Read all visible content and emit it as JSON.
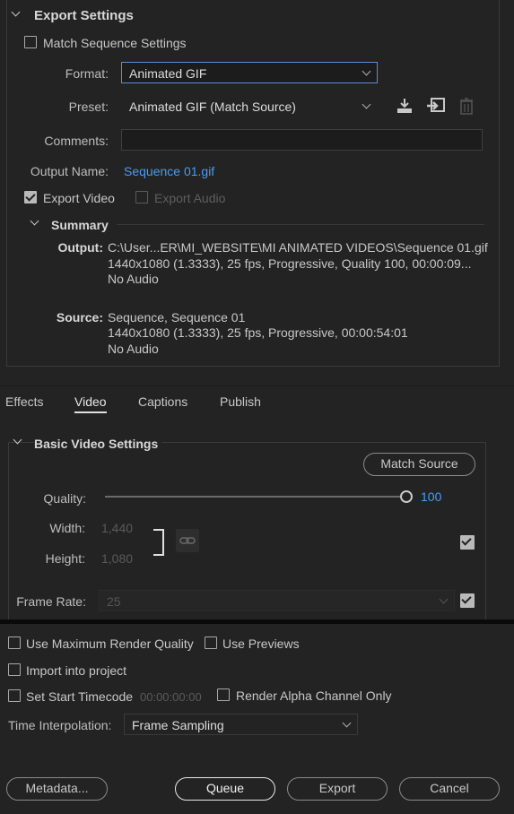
{
  "export_settings": {
    "title": "Export Settings",
    "match_sequence_label": "Match Sequence Settings",
    "format_label": "Format:",
    "format_value": "Animated GIF",
    "preset_label": "Preset:",
    "preset_value": "Animated GIF (Match Source)",
    "comments_label": "Comments:",
    "comments_value": "",
    "output_name_label": "Output Name:",
    "output_name_value": "Sequence 01.gif",
    "export_video_label": "Export Video",
    "export_audio_label": "Export Audio",
    "summary": {
      "title": "Summary",
      "output_label": "Output:",
      "output_lines": [
        "C:\\User...ER\\MI_WEBSITE\\MI ANIMATED VIDEOS\\Sequence 01.gif",
        "1440x1080 (1.3333), 25 fps, Progressive, Quality 100, 00:00:09...",
        "No Audio"
      ],
      "source_label": "Source:",
      "source_lines": [
        "Sequence, Sequence 01",
        "1440x1080 (1.3333), 25 fps, Progressive, 00:00:54:01",
        "No Audio"
      ]
    }
  },
  "tabs": [
    {
      "label": "Effects",
      "active": false
    },
    {
      "label": "Video",
      "active": true
    },
    {
      "label": "Captions",
      "active": false
    },
    {
      "label": "Publish",
      "active": false
    }
  ],
  "video": {
    "section_title": "Basic Video Settings",
    "match_source_label": "Match Source",
    "quality_label": "Quality:",
    "quality_value": "100",
    "quality_fraction": 1.0,
    "width_label": "Width:",
    "width_value": "1,440",
    "height_label": "Height:",
    "height_value": "1,080",
    "frame_rate_label": "Frame Rate:",
    "frame_rate_value": "25"
  },
  "options": {
    "max_render_label": "Use Maximum Render Quality",
    "use_previews_label": "Use Previews",
    "import_label": "Import into project",
    "set_start_tc_label": "Set Start Timecode",
    "start_tc_value": "00:00:00:00",
    "render_alpha_label": "Render Alpha Channel Only",
    "time_interp_label": "Time Interpolation:",
    "time_interp_value": "Frame Sampling"
  },
  "buttons": {
    "metadata": "Metadata...",
    "queue": "Queue",
    "export": "Export",
    "cancel": "Cancel"
  },
  "colors": {
    "accent_link": "#4a9cf0",
    "focus_border": "#5b8fd6"
  },
  "icons": [
    "save-preset-icon",
    "import-preset-icon",
    "delete-preset-icon",
    "link-icon",
    "chevron-down-icon"
  ]
}
